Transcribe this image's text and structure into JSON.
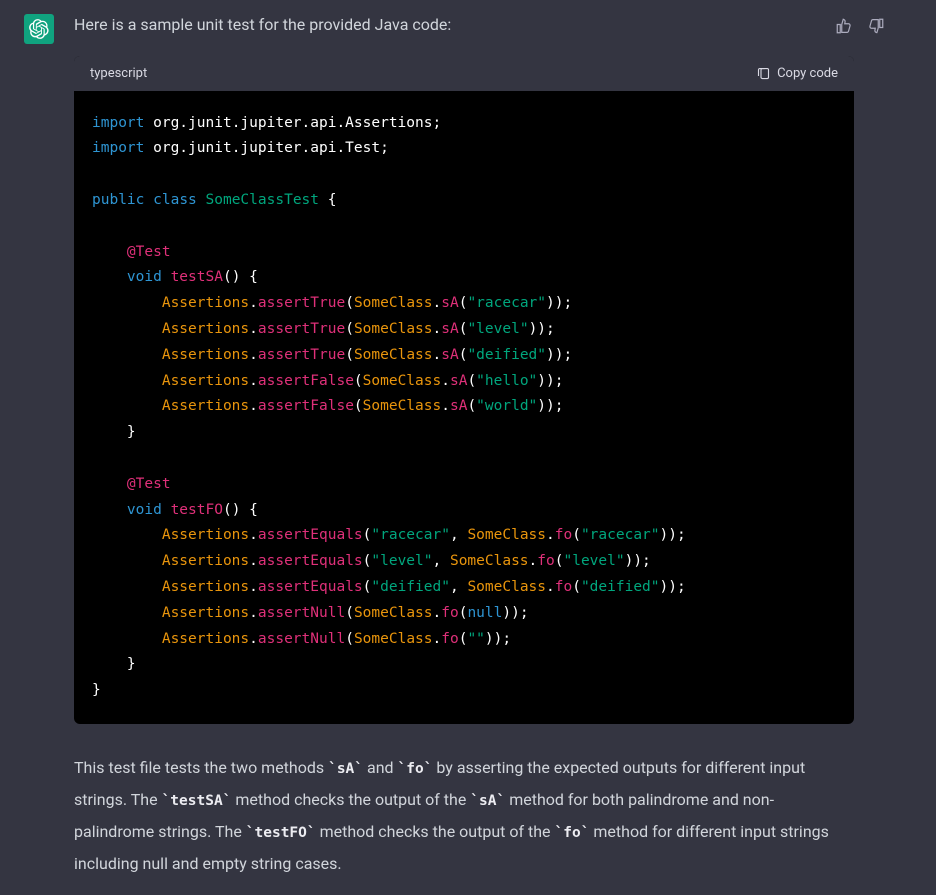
{
  "intro": "Here is a sample unit test for the provided Java code:",
  "code": {
    "language": "typescript",
    "copy_label": "Copy code",
    "tokens": [
      [
        [
          "kw",
          "import"
        ],
        [
          "",
          " org.junit.jupiter.api.Assertions;"
        ]
      ],
      [
        [
          "kw",
          "import"
        ],
        [
          "",
          " org.junit.jupiter.api.Test;"
        ]
      ],
      [],
      [
        [
          "kw",
          "public"
        ],
        [
          "",
          " "
        ],
        [
          "kw",
          "class"
        ],
        [
          "",
          " "
        ],
        [
          "cls",
          "SomeClassTest"
        ],
        [
          "",
          " {"
        ]
      ],
      [],
      [
        [
          "",
          "    "
        ],
        [
          "ann",
          "@Test"
        ]
      ],
      [
        [
          "",
          "    "
        ],
        [
          "kw",
          "void"
        ],
        [
          "",
          " "
        ],
        [
          "fn",
          "testSA"
        ],
        [
          "",
          "() {"
        ]
      ],
      [
        [
          "",
          "        "
        ],
        [
          "typ",
          "Assertions"
        ],
        [
          "",
          "."
        ],
        [
          "fn",
          "assertTrue"
        ],
        [
          "",
          "("
        ],
        [
          "typ",
          "SomeClass"
        ],
        [
          "",
          "."
        ],
        [
          "fn",
          "sA"
        ],
        [
          "",
          "("
        ],
        [
          "str",
          "\"racecar\""
        ],
        [
          "",
          "));"
        ]
      ],
      [
        [
          "",
          "        "
        ],
        [
          "typ",
          "Assertions"
        ],
        [
          "",
          "."
        ],
        [
          "fn",
          "assertTrue"
        ],
        [
          "",
          "("
        ],
        [
          "typ",
          "SomeClass"
        ],
        [
          "",
          "."
        ],
        [
          "fn",
          "sA"
        ],
        [
          "",
          "("
        ],
        [
          "str",
          "\"level\""
        ],
        [
          "",
          "));"
        ]
      ],
      [
        [
          "",
          "        "
        ],
        [
          "typ",
          "Assertions"
        ],
        [
          "",
          "."
        ],
        [
          "fn",
          "assertTrue"
        ],
        [
          "",
          "("
        ],
        [
          "typ",
          "SomeClass"
        ],
        [
          "",
          "."
        ],
        [
          "fn",
          "sA"
        ],
        [
          "",
          "("
        ],
        [
          "str",
          "\"deified\""
        ],
        [
          "",
          "));"
        ]
      ],
      [
        [
          "",
          "        "
        ],
        [
          "typ",
          "Assertions"
        ],
        [
          "",
          "."
        ],
        [
          "fn",
          "assertFalse"
        ],
        [
          "",
          "("
        ],
        [
          "typ",
          "SomeClass"
        ],
        [
          "",
          "."
        ],
        [
          "fn",
          "sA"
        ],
        [
          "",
          "("
        ],
        [
          "str",
          "\"hello\""
        ],
        [
          "",
          "));"
        ]
      ],
      [
        [
          "",
          "        "
        ],
        [
          "typ",
          "Assertions"
        ],
        [
          "",
          "."
        ],
        [
          "fn",
          "assertFalse"
        ],
        [
          "",
          "("
        ],
        [
          "typ",
          "SomeClass"
        ],
        [
          "",
          "."
        ],
        [
          "fn",
          "sA"
        ],
        [
          "",
          "("
        ],
        [
          "str",
          "\"world\""
        ],
        [
          "",
          "));"
        ]
      ],
      [
        [
          "",
          "    }"
        ]
      ],
      [],
      [
        [
          "",
          "    "
        ],
        [
          "ann",
          "@Test"
        ]
      ],
      [
        [
          "",
          "    "
        ],
        [
          "kw",
          "void"
        ],
        [
          "",
          " "
        ],
        [
          "fn",
          "testFO"
        ],
        [
          "",
          "() {"
        ]
      ],
      [
        [
          "",
          "        "
        ],
        [
          "typ",
          "Assertions"
        ],
        [
          "",
          "."
        ],
        [
          "fn",
          "assertEquals"
        ],
        [
          "",
          "("
        ],
        [
          "str",
          "\"racecar\""
        ],
        [
          "",
          ", "
        ],
        [
          "typ",
          "SomeClass"
        ],
        [
          "",
          "."
        ],
        [
          "fn",
          "fo"
        ],
        [
          "",
          "("
        ],
        [
          "str",
          "\"racecar\""
        ],
        [
          "",
          "));"
        ]
      ],
      [
        [
          "",
          "        "
        ],
        [
          "typ",
          "Assertions"
        ],
        [
          "",
          "."
        ],
        [
          "fn",
          "assertEquals"
        ],
        [
          "",
          "("
        ],
        [
          "str",
          "\"level\""
        ],
        [
          "",
          ", "
        ],
        [
          "typ",
          "SomeClass"
        ],
        [
          "",
          "."
        ],
        [
          "fn",
          "fo"
        ],
        [
          "",
          "("
        ],
        [
          "str",
          "\"level\""
        ],
        [
          "",
          "));"
        ]
      ],
      [
        [
          "",
          "        "
        ],
        [
          "typ",
          "Assertions"
        ],
        [
          "",
          "."
        ],
        [
          "fn",
          "assertEquals"
        ],
        [
          "",
          "("
        ],
        [
          "str",
          "\"deified\""
        ],
        [
          "",
          ", "
        ],
        [
          "typ",
          "SomeClass"
        ],
        [
          "",
          "."
        ],
        [
          "fn",
          "fo"
        ],
        [
          "",
          "("
        ],
        [
          "str",
          "\"deified\""
        ],
        [
          "",
          "));"
        ]
      ],
      [
        [
          "",
          "        "
        ],
        [
          "typ",
          "Assertions"
        ],
        [
          "",
          "."
        ],
        [
          "fn",
          "assertNull"
        ],
        [
          "",
          "("
        ],
        [
          "typ",
          "SomeClass"
        ],
        [
          "",
          "."
        ],
        [
          "fn",
          "fo"
        ],
        [
          "",
          "("
        ],
        [
          "lit",
          "null"
        ],
        [
          "",
          "));"
        ]
      ],
      [
        [
          "",
          "        "
        ],
        [
          "typ",
          "Assertions"
        ],
        [
          "",
          "."
        ],
        [
          "fn",
          "assertNull"
        ],
        [
          "",
          "("
        ],
        [
          "typ",
          "SomeClass"
        ],
        [
          "",
          "."
        ],
        [
          "fn",
          "fo"
        ],
        [
          "",
          "("
        ],
        [
          "str",
          "\"\""
        ],
        [
          "",
          "));"
        ]
      ],
      [
        [
          "",
          "    }"
        ]
      ],
      [
        [
          "",
          "}"
        ]
      ]
    ]
  },
  "explanation": {
    "parts": [
      {
        "t": "text",
        "v": "This test file tests the two methods "
      },
      {
        "t": "code",
        "v": "`sA`"
      },
      {
        "t": "text",
        "v": " and "
      },
      {
        "t": "code",
        "v": "`fo`"
      },
      {
        "t": "text",
        "v": " by asserting the expected outputs for different input strings. The "
      },
      {
        "t": "code",
        "v": "`testSA`"
      },
      {
        "t": "text",
        "v": " method checks the output of the "
      },
      {
        "t": "code",
        "v": "`sA`"
      },
      {
        "t": "text",
        "v": " method for both palindrome and non-palindrome strings. The "
      },
      {
        "t": "code",
        "v": "`testFO`"
      },
      {
        "t": "text",
        "v": " method checks the output of the "
      },
      {
        "t": "code",
        "v": "`fo`"
      },
      {
        "t": "text",
        "v": " method for different input strings including null and empty string cases."
      }
    ]
  }
}
